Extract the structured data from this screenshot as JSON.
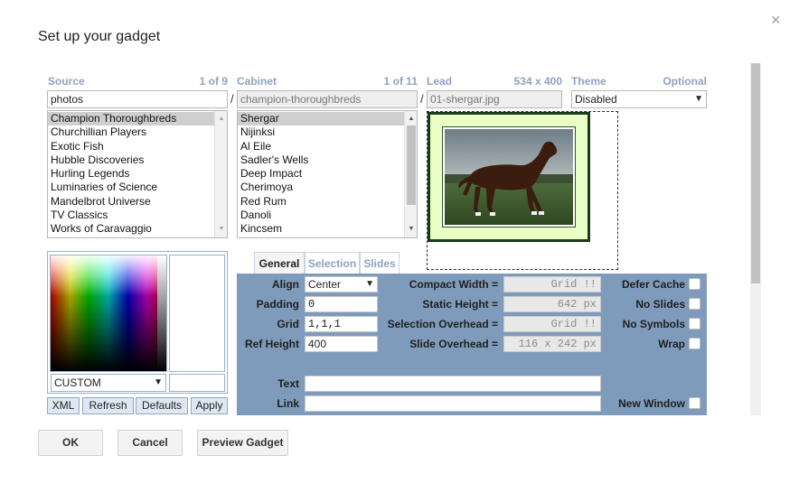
{
  "dialog": {
    "title": "Set up your gadget",
    "close_glyph": "×"
  },
  "source": {
    "label": "Source",
    "count": "1 of 9",
    "value": "photos",
    "items": [
      "Champion Thoroughbreds",
      "Churchillian Players",
      "Exotic Fish",
      "Hubble Discoveries",
      "Hurling Legends",
      "Luminaries of Science",
      "Mandelbrot Universe",
      "TV Classics",
      "Works of Caravaggio"
    ],
    "selected_index": 0
  },
  "cabinet": {
    "label": "Cabinet",
    "count": "1 of 11",
    "value": "champion-thoroughbreds",
    "items": [
      "Shergar",
      "Nijinksi",
      "Al Eile",
      "Sadler's Wells",
      "Deep Impact",
      "Cherimoya",
      "Red Rum",
      "Danoli",
      "Kincsem"
    ],
    "selected_index": 0
  },
  "lead": {
    "label": "Lead",
    "dimensions": "534 x 400",
    "value": "01-shergar.jpg"
  },
  "theme": {
    "label": "Theme",
    "optional": "Optional",
    "value": "Disabled"
  },
  "separator": "/",
  "color_picker": {
    "mode": "CUSTOM",
    "hex_value": ""
  },
  "picker_buttons": {
    "xml": "XML",
    "refresh": "Refresh",
    "defaults": "Defaults",
    "apply": "Apply"
  },
  "tabs": [
    {
      "label": "General",
      "active": true
    },
    {
      "label": "Selection",
      "active": false
    },
    {
      "label": "Slides",
      "active": false
    }
  ],
  "general": {
    "align_label": "Align",
    "align_value": "Center",
    "padding_label": "Padding",
    "padding_value": "0",
    "grid_label": "Grid",
    "grid_value": "1,1,1",
    "ref_height_label": "Ref Height",
    "ref_height_value": "400",
    "compact_width_label": "Compact Width =",
    "compact_width_value": "Grid !!",
    "static_height_label": "Static Height =",
    "static_height_value": "642 px",
    "selection_overhead_label": "Selection Overhead =",
    "selection_overhead_value": "Grid !!",
    "slide_overhead_label": "Slide Overhead =",
    "slide_overhead_value": "116 x 242 px",
    "defer_cache_label": "Defer Cache",
    "no_slides_label": "No Slides",
    "no_symbols_label": "No Symbols",
    "wrap_label": "Wrap",
    "text_label": "Text",
    "text_value": "",
    "link_label": "Link",
    "link_value": "",
    "new_window_label": "New Window"
  },
  "footer": {
    "ok": "OK",
    "cancel": "Cancel",
    "preview": "Preview Gadget"
  },
  "colors": {
    "accent_label": "#8fa3bf",
    "panel": "#7f9bbb",
    "thumb_bg": "#eaffc6",
    "thumb_border": "#1a3a1a"
  }
}
